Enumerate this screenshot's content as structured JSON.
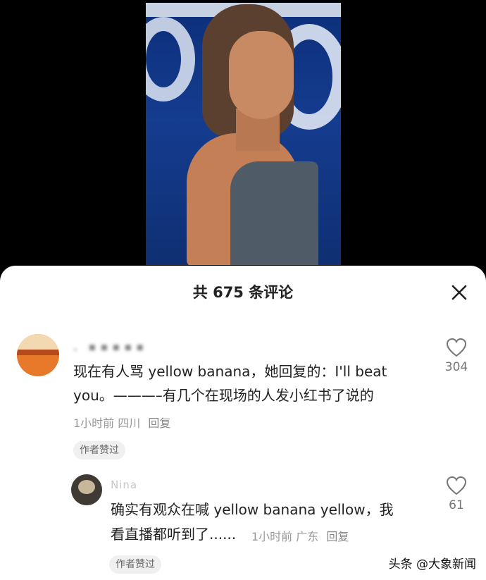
{
  "video": {
    "description_icon": "video-frame"
  },
  "sheet": {
    "title": "共 675 条评论",
    "close_icon": "close-icon"
  },
  "comments": [
    {
      "username": "、 ▪ ▪ ▪ ▪ ▪",
      "text_line1": "现在有人骂 yellow banana，她回复的：I'll beat",
      "text_line2": "you。———–有几个在现场的人发小红书了说的",
      "time": "1小时前",
      "location": "四川",
      "reply_label": "回复",
      "badge": "作者赞过",
      "likes": "304"
    },
    {
      "username": "Nina",
      "text_line1": "确实有观众在喊 yellow banana yellow，我",
      "text_line2": "看直播都听到了......",
      "time": "1小时前",
      "location": "广东",
      "reply_label": "回复",
      "badge": "作者赞过",
      "likes": "61"
    }
  ],
  "watermark": "头条 @大象新闻"
}
